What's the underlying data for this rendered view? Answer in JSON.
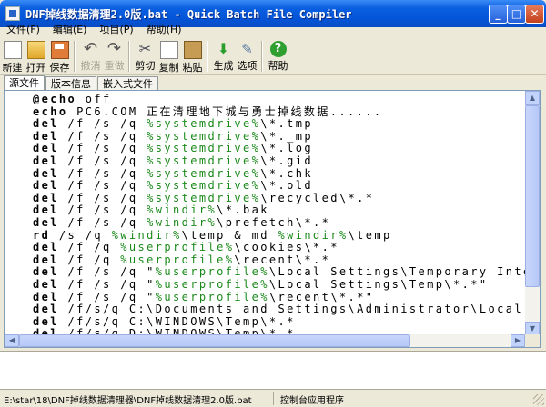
{
  "window": {
    "title": "DNF掉线数据清理2.0版.bat - Quick Batch File Compiler",
    "min_glyph": "_",
    "max_glyph": "□",
    "close_glyph": "✕"
  },
  "menu": [
    "文件(F)",
    "编辑(E)",
    "项目(P)",
    "帮助(H)"
  ],
  "toolbar": [
    {
      "label": "新建",
      "icon": "new-file-icon",
      "enabled": true
    },
    {
      "label": "打开",
      "icon": "open-folder-icon",
      "enabled": true
    },
    {
      "label": "保存",
      "icon": "save-disk-icon",
      "enabled": true
    },
    {
      "label": "撤消",
      "icon": "undo-icon",
      "enabled": false
    },
    {
      "label": "重做",
      "icon": "redo-icon",
      "enabled": false
    },
    {
      "label": "剪切",
      "icon": "cut-icon",
      "enabled": true
    },
    {
      "label": "复制",
      "icon": "copy-icon",
      "enabled": true
    },
    {
      "label": "粘贴",
      "icon": "paste-icon",
      "enabled": true
    },
    {
      "label": "生成",
      "icon": "build-icon",
      "enabled": true
    },
    {
      "label": "选项",
      "icon": "options-icon",
      "enabled": true
    },
    {
      "label": "帮助",
      "icon": "help-icon",
      "enabled": true
    }
  ],
  "tabs": [
    {
      "label": "源文件",
      "active": true
    },
    {
      "label": "版本信息",
      "active": false
    },
    {
      "label": "嵌入式文件",
      "active": false
    }
  ],
  "code_lines": [
    "@echo off",
    "echo PC6.COM 正在清理地下城与勇士掉线数据......",
    "del /f /s /q %systemdrive%\\*.tmp",
    "del /f /s /q %systemdrive%\\*._mp",
    "del /f /s /q %systemdrive%\\*.log",
    "del /f /s /q %systemdrive%\\*.gid",
    "del /f /s /q %systemdrive%\\*.chk",
    "del /f /s /q %systemdrive%\\*.old",
    "del /f /s /q %systemdrive%\\recycled\\*.*",
    "del /f /s /q %windir%\\*.bak",
    "del /f /s /q %windir%\\prefetch\\*.*",
    "rd /s /q %windir%\\temp & md %windir%\\temp",
    "del /f /q %userprofile%\\cookies\\*.*",
    "del /f /q %userprofile%\\recent\\*.*",
    "del /f /s /q \"%userprofile%\\Local Settings\\Temporary Internet Files\\*.*\"",
    "del /f /s /q \"%userprofile%\\Local Settings\\Temp\\*.*\"",
    "del /f /s /q \"%userprofile%\\recent\\*.*\"",
    "del /f/s/q C:\\Documents and Settings\\Administrator\\Local Settings\\Temp\\*.*",
    "del /f/s/q C:\\WINDOWS\\Temp\\*.*",
    "del /f/s/q D:\\WINDOWS\\Temp\\*.*"
  ],
  "status": {
    "path": "E:\\star\\18\\DNF掉线数据清理器\\DNF掉线数据清理2.0版.bat",
    "type": "控制台应用程序"
  },
  "colors": {
    "titlebar": "#0454d8",
    "variable": "#1b8a1b",
    "chrome": "#ece9d8"
  }
}
